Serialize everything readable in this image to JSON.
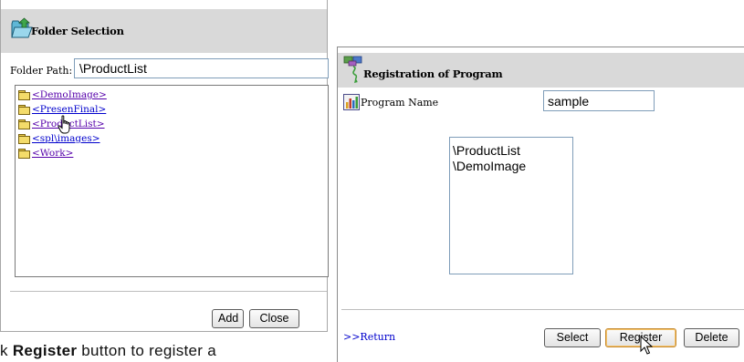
{
  "folder_dialog": {
    "title": "Folder Selection",
    "path_label": "Folder Path:",
    "path_value": "\\ProductList",
    "folders": [
      {
        "label": "<DemoImage>"
      },
      {
        "label": "<PresenFinal>"
      },
      {
        "label": "<ProductList>"
      },
      {
        "label": "<spl\\images>"
      },
      {
        "label": "<Work>"
      }
    ],
    "add_label": "Add",
    "close_label": "Close"
  },
  "registration_dialog": {
    "title": "Registration of Program",
    "program_name_label": "Program Name",
    "program_name_value": "sample",
    "registered_folders": [
      "\\ProductList",
      "\\DemoImage"
    ],
    "return_label": ">>Return",
    "select_label": "Select",
    "register_label": "Register",
    "delete_label": "Delete"
  },
  "caption": {
    "prefix": "k ",
    "bold": "Register",
    "suffix": " button to register a"
  },
  "icons": {
    "folder_title_icon": "folder-open-icon",
    "registration_title_icon": "program-registration-icon",
    "program_name_icon": "chart-icon",
    "tree_folder_icon": "folder-icon",
    "cursor": "hand-pointer-icon"
  }
}
